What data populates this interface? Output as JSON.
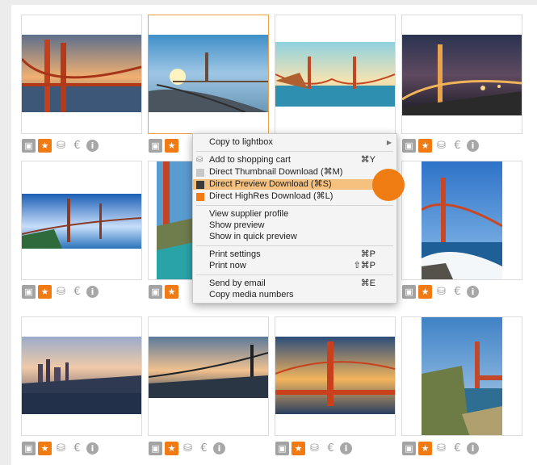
{
  "grid": {
    "tiles": [
      {
        "name": "tile-1",
        "image": "golden-gate-sunset-closeup",
        "selected": false
      },
      {
        "name": "tile-2",
        "image": "golden-gate-from-shore-sunset",
        "selected": true
      },
      {
        "name": "tile-3",
        "image": "golden-gate-wide-retro",
        "selected": false
      },
      {
        "name": "tile-4",
        "image": "golden-gate-night-lights",
        "selected": false
      },
      {
        "name": "tile-5",
        "image": "golden-gate-blue-sky-wide",
        "selected": false
      },
      {
        "name": "tile-6",
        "image": "golden-gate-portrait-partial",
        "selected": false
      },
      {
        "name": "tile-7",
        "image": "hidden-by-menu",
        "selected": false
      },
      {
        "name": "tile-8",
        "image": "golden-gate-waves-portrait",
        "selected": false
      },
      {
        "name": "tile-9",
        "image": "san-francisco-skyline-dusk",
        "selected": false
      },
      {
        "name": "tile-10",
        "image": "golden-gate-silhouette-sunset",
        "selected": false
      },
      {
        "name": "tile-11",
        "image": "golden-gate-warm-evening",
        "selected": false
      },
      {
        "name": "tile-12",
        "image": "golden-gate-portrait-coast",
        "selected": false
      }
    ],
    "toolbar_icons": [
      "lightbox-icon",
      "star-icon",
      "basket-icon",
      "euro-icon",
      "info-icon"
    ]
  },
  "context_menu": {
    "items": [
      {
        "label": "Copy to lightbox",
        "shortcut": "",
        "submenu": true
      },
      {
        "label": "Add to shopping cart",
        "shortcut": "⌘Y",
        "icon": "basket-icon"
      },
      {
        "label": "Direct Thumbnail Download  (⌘M)",
        "shortcut": "",
        "icon": "square-light-icon"
      },
      {
        "label": "Direct Preview Download  (⌘S)",
        "shortcut": "",
        "icon": "square-dark-icon",
        "highlighted": true
      },
      {
        "label": "Direct HighRes Download  (⌘L)",
        "shortcut": "",
        "icon": "square-orange-icon"
      },
      {
        "label": "View supplier profile",
        "shortcut": ""
      },
      {
        "label": "Show preview",
        "shortcut": ""
      },
      {
        "label": "Show in quick preview",
        "shortcut": ""
      },
      {
        "label": "Print settings",
        "shortcut": "⌘P"
      },
      {
        "label": "Print now",
        "shortcut": "⇧⌘P"
      },
      {
        "label": "Send by email",
        "shortcut": "⌘E"
      },
      {
        "label": "Copy media numbers",
        "shortcut": ""
      }
    ]
  },
  "colors": {
    "accent": "#f27a13",
    "highlight": "#f6c17e",
    "border": "#dcdcdc"
  }
}
